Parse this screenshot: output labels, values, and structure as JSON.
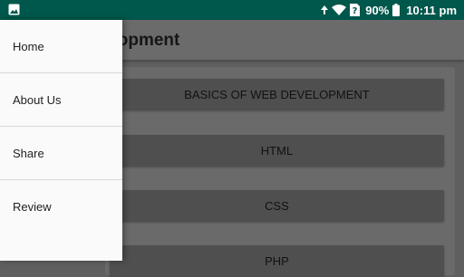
{
  "status_bar": {
    "battery": "90%",
    "time": "10:11",
    "time_suffix": "pm",
    "icons": [
      "image-icon",
      "upload-arrow-icon",
      "wifi-icon",
      "sim-unknown-icon",
      "battery-icon"
    ]
  },
  "app_bar": {
    "title": "Web Development"
  },
  "drawer": {
    "items": [
      {
        "label": "Home"
      },
      {
        "label": "About Us"
      },
      {
        "label": "Share"
      },
      {
        "label": "Review"
      }
    ]
  },
  "topics": [
    {
      "label": "BASICS OF WEB DEVELOPMENT"
    },
    {
      "label": "HTML"
    },
    {
      "label": "CSS"
    },
    {
      "label": "PHP"
    }
  ],
  "colors": {
    "status_bar": "#00574b",
    "scrim_bg": "#5f5f5f",
    "drawer_bg": "#fafafa"
  }
}
